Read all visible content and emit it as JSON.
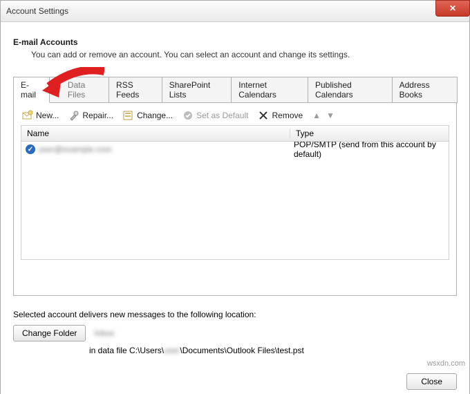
{
  "window": {
    "title": "Account Settings"
  },
  "header": {
    "section_title": "E-mail Accounts",
    "section_desc": "You can add or remove an account. You can select an account and change its settings."
  },
  "tabs": {
    "items": [
      {
        "label": "E-mail",
        "active": true
      },
      {
        "label": "Data Files"
      },
      {
        "label": "RSS Feeds"
      },
      {
        "label": "SharePoint Lists"
      },
      {
        "label": "Internet Calendars"
      },
      {
        "label": "Published Calendars"
      },
      {
        "label": "Address Books"
      }
    ]
  },
  "toolbar": {
    "new_label": "New...",
    "repair_label": "Repair...",
    "change_label": "Change...",
    "default_label": "Set as Default",
    "remove_label": "Remove"
  },
  "table": {
    "col_name": "Name",
    "col_type": "Type",
    "rows": [
      {
        "name": "user@example.com",
        "type": "POP/SMTP (send from this account by default)"
      }
    ]
  },
  "lower": {
    "text": "Selected account delivers new messages to the following location:",
    "change_folder": "Change Folder",
    "folder_name": "Inbox",
    "path_prefix": "in data file C:\\Users\\",
    "path_user": "user",
    "path_suffix": "\\Documents\\Outlook Files\\test.pst"
  },
  "buttons": {
    "close": "Close"
  },
  "watermark": "wsxdn.com"
}
